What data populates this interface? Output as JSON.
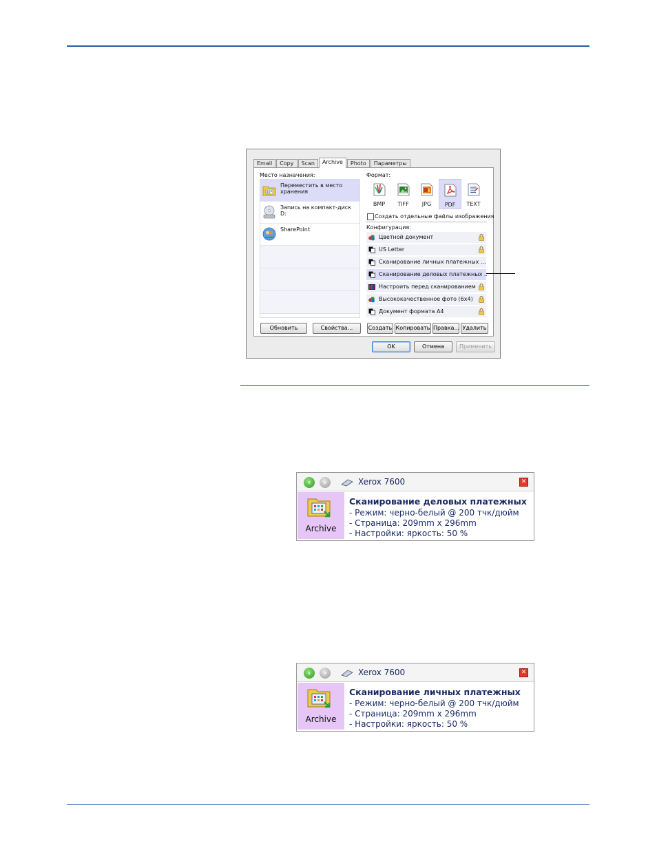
{
  "dialog": {
    "tabs": [
      "Email",
      "Copy",
      "Scan",
      "Archive",
      "Photo",
      "Параметры"
    ],
    "active_tab": "Archive",
    "destination_label": "Место назначения:",
    "destinations": [
      {
        "label": "Переместить в место хранения",
        "icon": "folder-archive-icon",
        "selected": true
      },
      {
        "label": "Запись на компакт-диск  D:",
        "icon": "cd-drive-icon",
        "selected": false
      },
      {
        "label": "SharePoint",
        "icon": "sharepoint-icon",
        "selected": false
      }
    ],
    "format_label": "Формат:",
    "formats": [
      {
        "label": "BMP",
        "icon": "bmp-icon",
        "selected": false
      },
      {
        "label": "TIFF",
        "icon": "tiff-icon",
        "selected": false
      },
      {
        "label": "JPG",
        "icon": "jpg-icon",
        "selected": false
      },
      {
        "label": "PDF",
        "icon": "pdf-icon",
        "selected": true
      },
      {
        "label": "TEXT",
        "icon": "text-icon",
        "selected": false
      }
    ],
    "separate_files_label": "Создать отдельные файлы изображения",
    "config_label": "Конфигурация:",
    "configs": [
      {
        "label": "Цветной документ",
        "locked": true,
        "selected": false,
        "icon": "color-doc-icon"
      },
      {
        "label": "US Letter",
        "locked": true,
        "selected": false,
        "icon": "bw-doc-icon"
      },
      {
        "label": "Сканирование личных платежных ...",
        "locked": false,
        "selected": false,
        "icon": "bw-doc-icon"
      },
      {
        "label": "Сканирование деловых платежных ..",
        "locked": false,
        "selected": true,
        "icon": "bw-doc-icon"
      },
      {
        "label": "Настроить перед сканированием",
        "locked": true,
        "selected": false,
        "icon": "configure-icon"
      },
      {
        "label": "Высококачественное фото (6x4)",
        "locked": true,
        "selected": false,
        "icon": "color-doc-icon"
      },
      {
        "label": "Документ формата A4",
        "locked": true,
        "selected": false,
        "icon": "bw-doc-icon"
      }
    ],
    "buttons": {
      "refresh": "Обновить",
      "properties": "Свойства...",
      "create": "Создать",
      "copy": "Копировать",
      "edit": "Правка...",
      "delete": "Удалить",
      "ok": "OK",
      "cancel": "Отмена",
      "apply": "Применить"
    }
  },
  "progress_windows": [
    {
      "device": "Xerox 7600",
      "app": "Archive",
      "title": "Сканирование деловых платежных",
      "lines": [
        "- Режим: черно-белый @ 200 тчк/дюйм",
        "- Страница:   209mm x   296mm",
        "- Настройки: яркость: 50 %"
      ]
    },
    {
      "device": "Xerox 7600",
      "app": "Archive",
      "title": "Сканирование личных платежных",
      "lines": [
        "- Режим: черно-белый @ 200 тчк/дюйм",
        "- Страница:   209mm x   296mm",
        "- Настройки: яркость: 50 %"
      ]
    }
  ],
  "colors": {
    "rule": "#2a5aa8",
    "selection": "#dcdcf8",
    "progress_text": "#1a2a66",
    "archive_panel": "#e6c6f6"
  }
}
